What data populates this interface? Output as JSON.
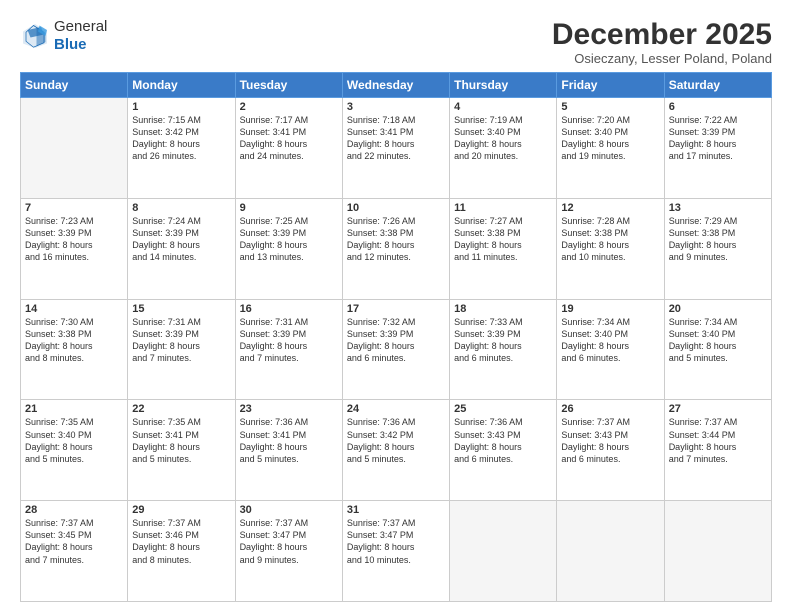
{
  "logo": {
    "general": "General",
    "blue": "Blue"
  },
  "title": "December 2025",
  "subtitle": "Osieczany, Lesser Poland, Poland",
  "headers": [
    "Sunday",
    "Monday",
    "Tuesday",
    "Wednesday",
    "Thursday",
    "Friday",
    "Saturday"
  ],
  "weeks": [
    [
      {
        "day": "",
        "info": ""
      },
      {
        "day": "1",
        "info": "Sunrise: 7:15 AM\nSunset: 3:42 PM\nDaylight: 8 hours\nand 26 minutes."
      },
      {
        "day": "2",
        "info": "Sunrise: 7:17 AM\nSunset: 3:41 PM\nDaylight: 8 hours\nand 24 minutes."
      },
      {
        "day": "3",
        "info": "Sunrise: 7:18 AM\nSunset: 3:41 PM\nDaylight: 8 hours\nand 22 minutes."
      },
      {
        "day": "4",
        "info": "Sunrise: 7:19 AM\nSunset: 3:40 PM\nDaylight: 8 hours\nand 20 minutes."
      },
      {
        "day": "5",
        "info": "Sunrise: 7:20 AM\nSunset: 3:40 PM\nDaylight: 8 hours\nand 19 minutes."
      },
      {
        "day": "6",
        "info": "Sunrise: 7:22 AM\nSunset: 3:39 PM\nDaylight: 8 hours\nand 17 minutes."
      }
    ],
    [
      {
        "day": "7",
        "info": "Sunrise: 7:23 AM\nSunset: 3:39 PM\nDaylight: 8 hours\nand 16 minutes."
      },
      {
        "day": "8",
        "info": "Sunrise: 7:24 AM\nSunset: 3:39 PM\nDaylight: 8 hours\nand 14 minutes."
      },
      {
        "day": "9",
        "info": "Sunrise: 7:25 AM\nSunset: 3:39 PM\nDaylight: 8 hours\nand 13 minutes."
      },
      {
        "day": "10",
        "info": "Sunrise: 7:26 AM\nSunset: 3:38 PM\nDaylight: 8 hours\nand 12 minutes."
      },
      {
        "day": "11",
        "info": "Sunrise: 7:27 AM\nSunset: 3:38 PM\nDaylight: 8 hours\nand 11 minutes."
      },
      {
        "day": "12",
        "info": "Sunrise: 7:28 AM\nSunset: 3:38 PM\nDaylight: 8 hours\nand 10 minutes."
      },
      {
        "day": "13",
        "info": "Sunrise: 7:29 AM\nSunset: 3:38 PM\nDaylight: 8 hours\nand 9 minutes."
      }
    ],
    [
      {
        "day": "14",
        "info": "Sunrise: 7:30 AM\nSunset: 3:38 PM\nDaylight: 8 hours\nand 8 minutes."
      },
      {
        "day": "15",
        "info": "Sunrise: 7:31 AM\nSunset: 3:39 PM\nDaylight: 8 hours\nand 7 minutes."
      },
      {
        "day": "16",
        "info": "Sunrise: 7:31 AM\nSunset: 3:39 PM\nDaylight: 8 hours\nand 7 minutes."
      },
      {
        "day": "17",
        "info": "Sunrise: 7:32 AM\nSunset: 3:39 PM\nDaylight: 8 hours\nand 6 minutes."
      },
      {
        "day": "18",
        "info": "Sunrise: 7:33 AM\nSunset: 3:39 PM\nDaylight: 8 hours\nand 6 minutes."
      },
      {
        "day": "19",
        "info": "Sunrise: 7:34 AM\nSunset: 3:40 PM\nDaylight: 8 hours\nand 6 minutes."
      },
      {
        "day": "20",
        "info": "Sunrise: 7:34 AM\nSunset: 3:40 PM\nDaylight: 8 hours\nand 5 minutes."
      }
    ],
    [
      {
        "day": "21",
        "info": "Sunrise: 7:35 AM\nSunset: 3:40 PM\nDaylight: 8 hours\nand 5 minutes."
      },
      {
        "day": "22",
        "info": "Sunrise: 7:35 AM\nSunset: 3:41 PM\nDaylight: 8 hours\nand 5 minutes."
      },
      {
        "day": "23",
        "info": "Sunrise: 7:36 AM\nSunset: 3:41 PM\nDaylight: 8 hours\nand 5 minutes."
      },
      {
        "day": "24",
        "info": "Sunrise: 7:36 AM\nSunset: 3:42 PM\nDaylight: 8 hours\nand 5 minutes."
      },
      {
        "day": "25",
        "info": "Sunrise: 7:36 AM\nSunset: 3:43 PM\nDaylight: 8 hours\nand 6 minutes."
      },
      {
        "day": "26",
        "info": "Sunrise: 7:37 AM\nSunset: 3:43 PM\nDaylight: 8 hours\nand 6 minutes."
      },
      {
        "day": "27",
        "info": "Sunrise: 7:37 AM\nSunset: 3:44 PM\nDaylight: 8 hours\nand 7 minutes."
      }
    ],
    [
      {
        "day": "28",
        "info": "Sunrise: 7:37 AM\nSunset: 3:45 PM\nDaylight: 8 hours\nand 7 minutes."
      },
      {
        "day": "29",
        "info": "Sunrise: 7:37 AM\nSunset: 3:46 PM\nDaylight: 8 hours\nand 8 minutes."
      },
      {
        "day": "30",
        "info": "Sunrise: 7:37 AM\nSunset: 3:47 PM\nDaylight: 8 hours\nand 9 minutes."
      },
      {
        "day": "31",
        "info": "Sunrise: 7:37 AM\nSunset: 3:47 PM\nDaylight: 8 hours\nand 10 minutes."
      },
      {
        "day": "",
        "info": ""
      },
      {
        "day": "",
        "info": ""
      },
      {
        "day": "",
        "info": ""
      }
    ]
  ]
}
